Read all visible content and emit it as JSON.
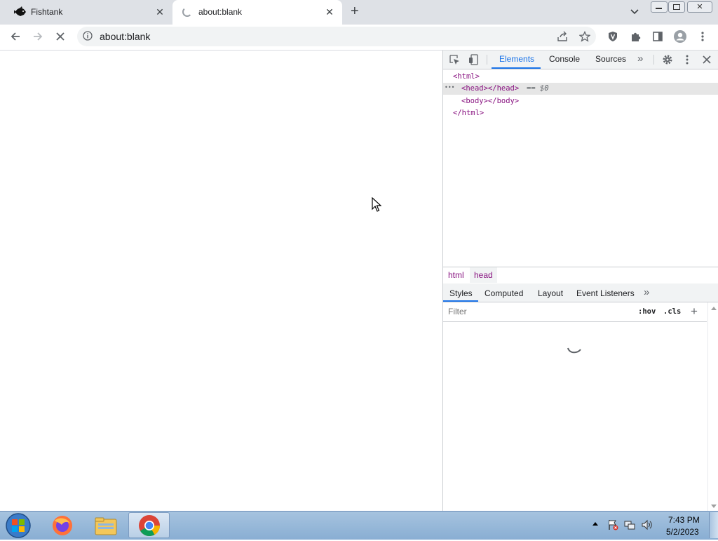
{
  "browser": {
    "tabs": [
      {
        "title": "Fishtank",
        "close": "✕"
      },
      {
        "title": "about:blank",
        "close": "✕"
      }
    ],
    "new_tab": "+",
    "tab_menu": "⌄",
    "address": "about:blank"
  },
  "devtools": {
    "tabs": [
      "Elements",
      "Console",
      "Sources"
    ],
    "more": "»",
    "dom": {
      "html_open": "<html>",
      "head": "<head></head>",
      "selected_marker": "== $0",
      "dots": "•••",
      "body": "<body></body>",
      "html_close": "</html>"
    },
    "breadcrumbs": [
      "html",
      "head"
    ],
    "subtabs": [
      "Styles",
      "Computed",
      "Layout",
      "Event Listeners"
    ],
    "subtabs_more": "»",
    "filter_placeholder": "Filter",
    "hov": ":hov",
    "cls": ".cls",
    "plus": "+"
  },
  "taskbar": {
    "time": "7:43 PM",
    "date": "5/2/2023"
  }
}
